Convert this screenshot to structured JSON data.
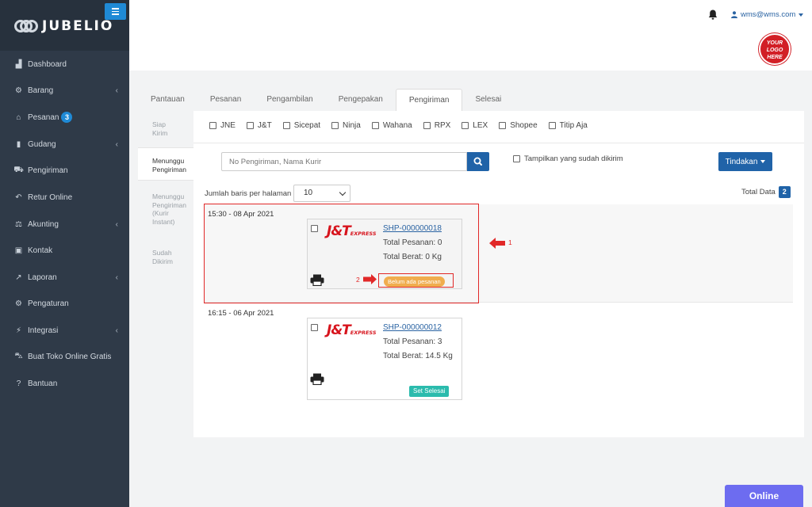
{
  "brand": {
    "name": "JUBELIO"
  },
  "sidebar": {
    "items": [
      {
        "label": "Dashboard",
        "icon": "chart-area-icon",
        "glyph": "▟",
        "chevron": false
      },
      {
        "label": "Barang",
        "icon": "bicycle-icon",
        "glyph": "⚙",
        "chevron": true
      },
      {
        "label": "Pesanan",
        "icon": "basket-icon",
        "glyph": "⌂",
        "chevron": false,
        "badge": "3"
      },
      {
        "label": "Gudang",
        "icon": "book-icon",
        "glyph": "▮",
        "chevron": true
      },
      {
        "label": "Pengiriman",
        "icon": "truck-icon",
        "glyph": "⛟",
        "chevron": false
      },
      {
        "label": "Retur Online",
        "icon": "reply-icon",
        "glyph": "↶",
        "chevron": false
      },
      {
        "label": "Akunting",
        "icon": "balance-scale-icon",
        "glyph": "⚖",
        "chevron": true
      },
      {
        "label": "Kontak",
        "icon": "id-card-icon",
        "glyph": "▣",
        "chevron": false
      },
      {
        "label": "Laporan",
        "icon": "line-chart-icon",
        "glyph": "↗",
        "chevron": true
      },
      {
        "label": "Pengaturan",
        "icon": "cogs-icon",
        "glyph": "⚙",
        "chevron": false
      },
      {
        "label": "Integrasi",
        "icon": "plug-icon",
        "glyph": "⚡",
        "chevron": true
      },
      {
        "label": "Buat Toko Online Gratis",
        "icon": "cart-icon",
        "glyph": "⛍",
        "chevron": false
      },
      {
        "label": "Bantuan",
        "icon": "question-circle-icon",
        "glyph": "?",
        "chevron": false
      }
    ]
  },
  "header": {
    "user_email": "wms@wms.com",
    "logo_text": [
      "YOUR",
      "LOGO",
      "HERE"
    ]
  },
  "tabs": [
    "Pantauan",
    "Pesanan",
    "Pengambilan",
    "Pengepakan",
    "Pengiriman",
    "Selesai"
  ],
  "active_tab": "Pengiriman",
  "subnav": {
    "siap_kirim": [
      "Siap",
      "Kirim"
    ],
    "menunggu": [
      "Menunggu",
      "Pengiriman"
    ],
    "menunggu_instant": [
      "Menunggu",
      "Pengiriman",
      "(Kurir",
      "Instant)"
    ],
    "sudah": [
      "Sudah",
      "Dikirim"
    ]
  },
  "couriers": [
    "JNE",
    "J&T",
    "Sicepat",
    "Ninja",
    "Wahana",
    "RPX",
    "LEX",
    "Shopee",
    "Titip Aja"
  ],
  "search": {
    "placeholder": "No Pengiriman, Nama Kurir"
  },
  "show_sent_label": "Tampilkan yang sudah dikirim",
  "action_button": "Tindakan",
  "rows_per_page": {
    "label": "Jumlah baris per halaman",
    "value": "10"
  },
  "total": {
    "label": "Total Data",
    "count": "2"
  },
  "groups": [
    {
      "date": "15:30 - 08 Apr 2021",
      "shipment_id": "SHP-000000018",
      "courier_logo": "J&T",
      "courier_logo_sub": "EXPRESS",
      "total_orders": "Total Pesanan: 0",
      "total_weight": "Total Berat: 0 Kg",
      "status_badge": "Belum ada pesanan"
    },
    {
      "date": "16:15 - 06 Apr 2021",
      "shipment_id": "SHP-000000012",
      "courier_logo": "J&T",
      "courier_logo_sub": "EXPRESS",
      "total_orders": "Total Pesanan: 3",
      "total_weight": "Total Berat: 14.5 Kg",
      "action_button": "Set Selesai"
    }
  ],
  "annotations": {
    "arrow1": "1",
    "arrow2": "2"
  },
  "chat": {
    "label": "Online"
  },
  "colors": {
    "sidebar": "#2f3a48",
    "primary": "#2063a8",
    "accent": "#1f8ad6",
    "warning": "#f0ad4e",
    "success": "#2bbbad",
    "highlight": "#e12828",
    "chat": "#6d6cf0"
  }
}
